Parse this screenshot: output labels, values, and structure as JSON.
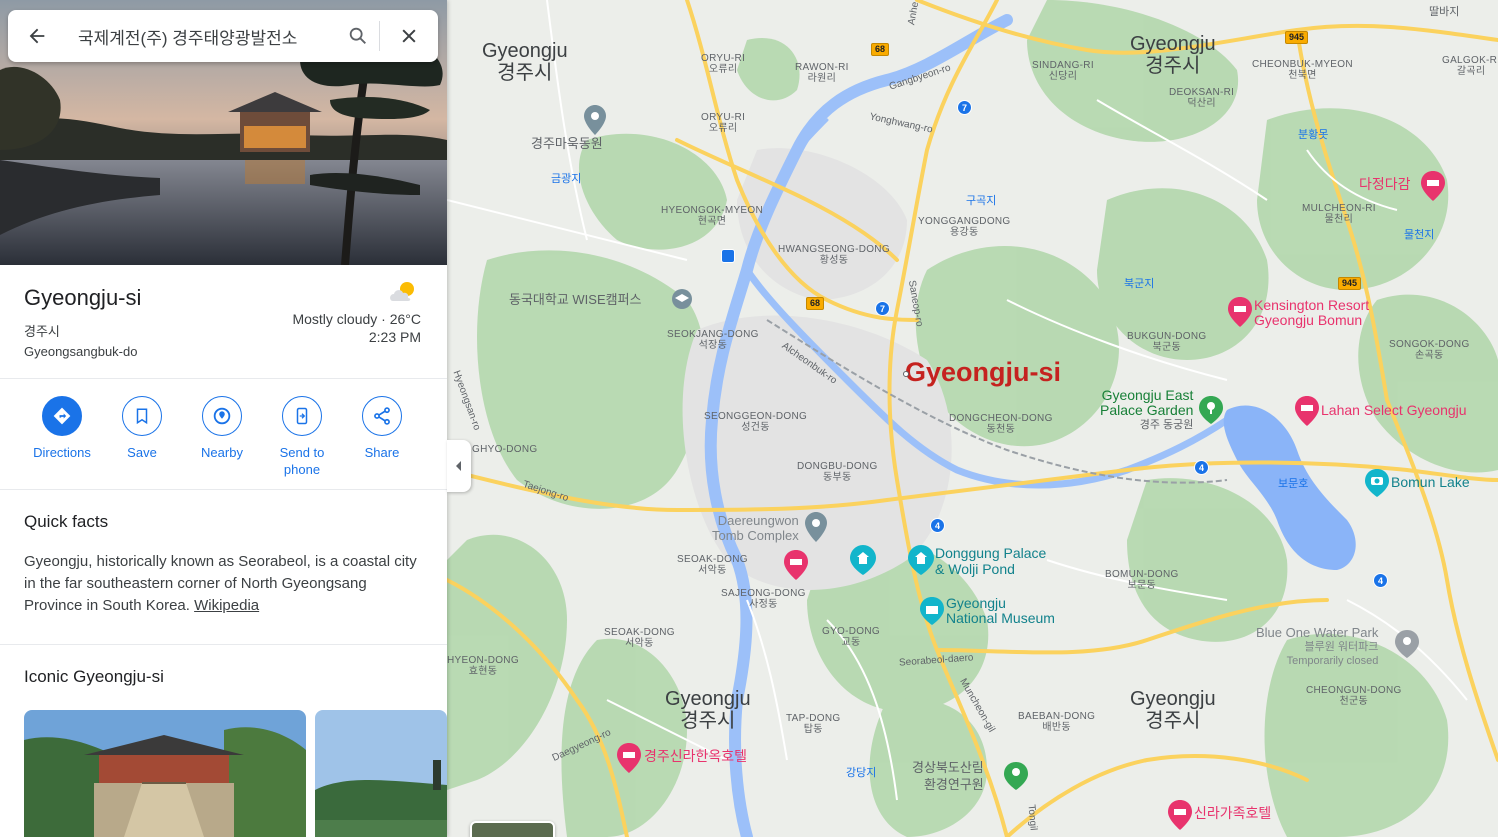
{
  "search": {
    "query": "국제계전(주) 경주태양광발전소"
  },
  "place": {
    "name": "Gyeongju-si",
    "name_local": "경주시",
    "region": "Gyeongsangbuk-do",
    "weather": "Mostly cloudy · 26°C",
    "time": "2:23 PM"
  },
  "actions": [
    {
      "label": "Directions",
      "icon": "directions-icon"
    },
    {
      "label": "Save",
      "icon": "bookmark-icon"
    },
    {
      "label": "Nearby",
      "icon": "nearby-icon"
    },
    {
      "label": "Send to phone",
      "label_line1": "Send to",
      "label_line2": "phone",
      "icon": "send-to-phone-icon"
    },
    {
      "label": "Share",
      "icon": "share-icon"
    }
  ],
  "quick_facts": {
    "title": "Quick facts",
    "text": "Gyeongju, historically known as Seorabeol, is a coastal city in the far southeastern corner of North Gyeongsang Province in South Korea.",
    "link": "Wikipedia"
  },
  "iconic": {
    "title": "Iconic Gyeongju-si"
  },
  "map": {
    "city_label": "Gyeongju-si",
    "region_labels": [
      {
        "en": "Gyeongju",
        "ko": "경주시"
      },
      {
        "en": "Gyeongju",
        "ko": "경주시"
      },
      {
        "en": "Gyeongju",
        "ko": "경주시"
      },
      {
        "en": "Gyeongju",
        "ko": "경주시"
      }
    ],
    "dongs": [
      {
        "en": "ORYU-RI",
        "ko": "오류리"
      },
      {
        "en": "ORYU-RI",
        "ko": "오류리"
      },
      {
        "en": "RAWON-RI",
        "ko": "라원리"
      },
      {
        "en": "SINDANG-RI",
        "ko": "신당리"
      },
      {
        "en": "DEOKSAN-RI",
        "ko": "덕산리"
      },
      {
        "en": "CHEONBUK-MYEON",
        "ko": "천북면"
      },
      {
        "en": "GALGOK-RI",
        "ko": "갈곡리"
      },
      {
        "en": "HYEONGOK-MYEON",
        "ko": "현곡면"
      },
      {
        "en": "HWANGSEONG-DONG",
        "ko": "황성동"
      },
      {
        "en": "YONGGANGDONG",
        "ko": "용강동"
      },
      {
        "en": "MULCHEON-RI",
        "ko": "물천리"
      },
      {
        "en": "SEOKJANG-DONG",
        "ko": "석장동"
      },
      {
        "en": "BUKGUN-DONG",
        "ko": "북군동"
      },
      {
        "en": "SONGOK-DONG",
        "ko": "손곡동"
      },
      {
        "en": "SEONGGEON-DONG",
        "ko": "성건동"
      },
      {
        "en": "DONGCHEON-DONG",
        "ko": "동천동"
      },
      {
        "en": "GHYO-DONG",
        "ko": ""
      },
      {
        "en": "DONGBU-DONG",
        "ko": "동부동"
      },
      {
        "en": "SEOAK-DONG",
        "ko": "서악동"
      },
      {
        "en": "SAJEONG-DONG",
        "ko": "사정동"
      },
      {
        "en": "BOMUN-DONG",
        "ko": "보문동"
      },
      {
        "en": "SEOAK-DONG",
        "ko": "서악동"
      },
      {
        "en": "GYO-DONG",
        "ko": "교동"
      },
      {
        "en": "HYEON-DONG",
        "ko": "효현동"
      },
      {
        "en": "TAP-DONG",
        "ko": "탑동"
      },
      {
        "en": "BAEBAN-DONG",
        "ko": "배반동"
      },
      {
        "en": "CHEONGUN-DONG",
        "ko": "천군동"
      }
    ],
    "small_places": [
      "금광지",
      "구곡지",
      "북군지",
      "물천지",
      "분황못",
      "보문호",
      "강당지"
    ],
    "pois": {
      "park1": "경주마욱동원",
      "univ": "동국대학교 WISE캠퍼스",
      "tomb": [
        "Daereungwon",
        "Tomb Complex"
      ],
      "palace": [
        "Donggung Palace",
        "& Wolji Pond"
      ],
      "museum": [
        "Gyeongju",
        "National Museum"
      ],
      "east_garden": [
        "Gyeongju East",
        "Palace Garden",
        "경주 동궁원"
      ],
      "bomun_lake": "Bomun Lake",
      "blue_one": [
        "Blue One Water Park",
        "블루원 워터파크",
        "Temporarily closed"
      ],
      "forest": [
        "경상북도산림",
        "환경연구원"
      ],
      "hotel1": "다정다감",
      "hotel2": [
        "Kensington Resort",
        "Gyeongju Bomun"
      ],
      "hotel3": "Lahan Select Gyeongju",
      "hotel4": "경주신라한옥호텔",
      "hotel5": "신라가족호텔"
    },
    "roads": [
      "Gangbyeon-ro",
      "Yonghwang-ro",
      "Alcheonbuk-ro",
      "Saneop-ro",
      "Taejong-ro",
      "Daegyeong-ro",
      "Seorabeol-daero",
      "Muncheon-gil",
      "Hyeongsan-ro",
      "Anhe",
      "Tongil"
    ],
    "shields": [
      "68",
      "68",
      "945",
      "945",
      "7",
      "7",
      "4",
      "4",
      "4"
    ],
    "top_right": "딸바지"
  }
}
